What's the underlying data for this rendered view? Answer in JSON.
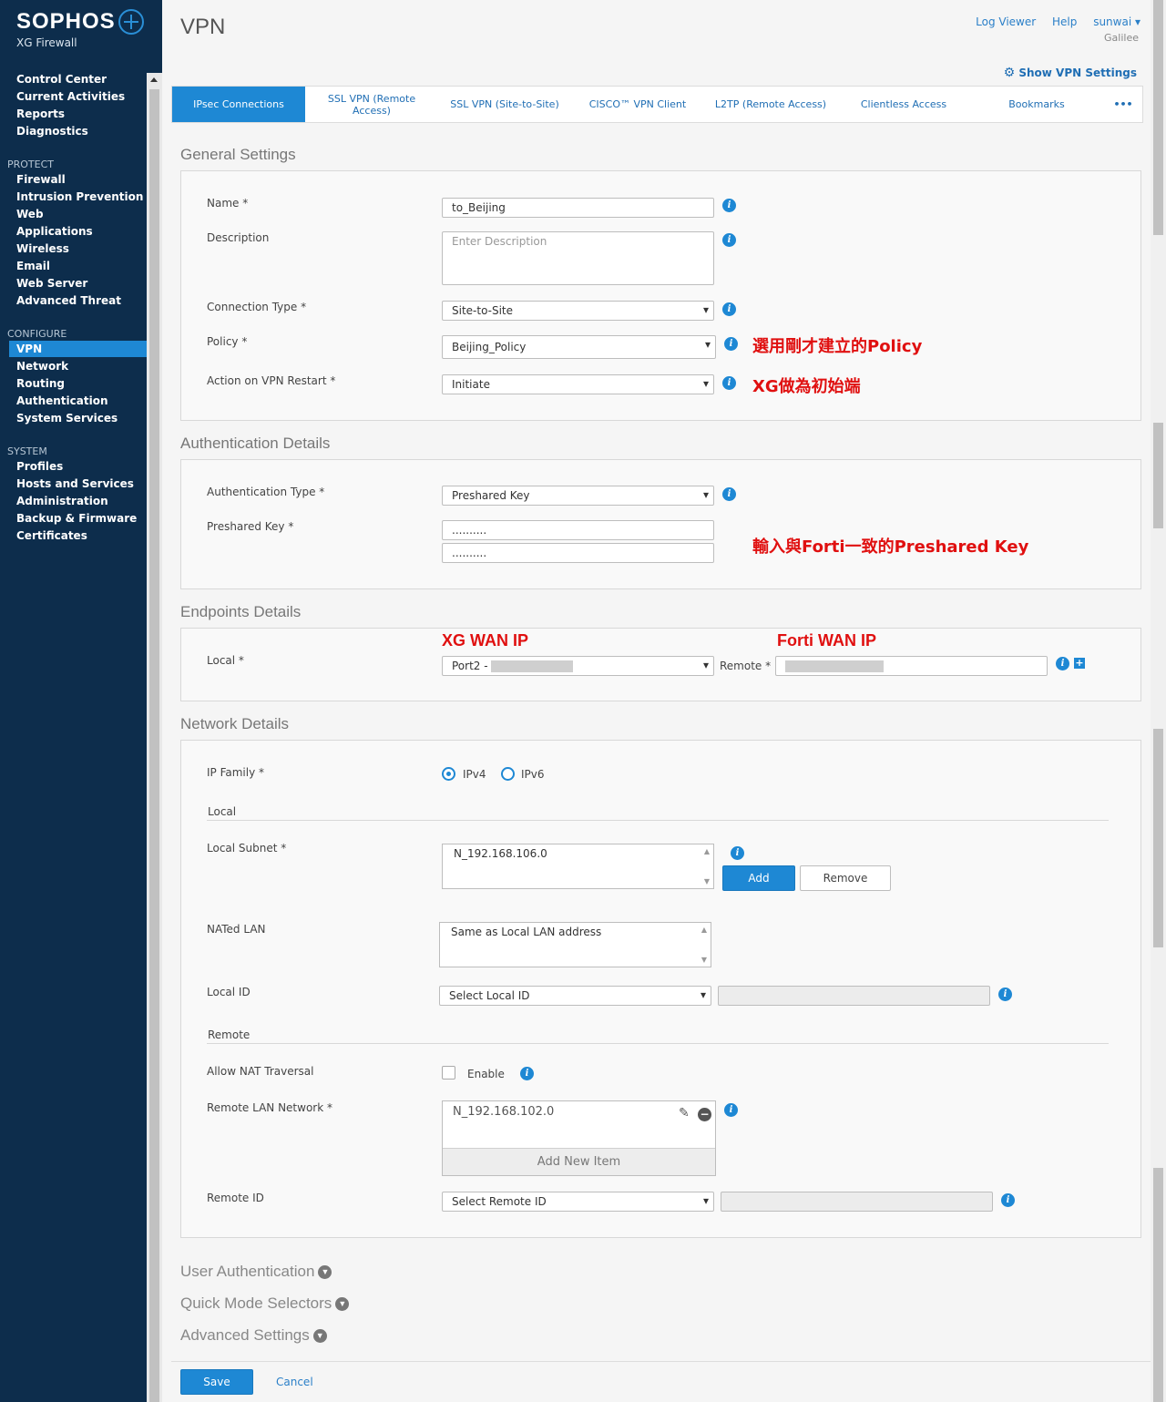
{
  "brand": {
    "name": "SOPHOS",
    "product": "XG Firewall"
  },
  "sidebar": {
    "top_items": [
      "Control Center",
      "Current Activities",
      "Reports",
      "Diagnostics"
    ],
    "protect_label": "PROTECT",
    "protect_items": [
      "Firewall",
      "Intrusion Prevention",
      "Web",
      "Applications",
      "Wireless",
      "Email",
      "Web Server",
      "Advanced Threat"
    ],
    "configure_label": "CONFIGURE",
    "configure_items": [
      "VPN",
      "Network",
      "Routing",
      "Authentication",
      "System Services"
    ],
    "system_label": "SYSTEM",
    "system_items": [
      "Profiles",
      "Hosts and Services",
      "Administration",
      "Backup & Firmware",
      "Certificates"
    ]
  },
  "header": {
    "title": "VPN",
    "log_viewer": "Log Viewer",
    "help": "Help",
    "user": "sunwai ▾",
    "device": "Galilee",
    "show_vpn_settings": "Show VPN Settings"
  },
  "tabs": [
    "IPsec Connections",
    "SSL VPN (Remote Access)",
    "SSL VPN (Site-to-Site)",
    "CISCO™ VPN Client",
    "L2TP (Remote Access)",
    "Clientless Access",
    "Bookmarks",
    "•••"
  ],
  "general": {
    "title": "General Settings",
    "name_label": "Name *",
    "name_value": "to_Beijing",
    "description_label": "Description",
    "description_placeholder": "Enter Description",
    "connection_type_label": "Connection Type *",
    "connection_type_value": "Site-to-Site",
    "policy_label": "Policy *",
    "policy_value": "Beijing_Policy",
    "action_label": "Action on VPN Restart *",
    "action_value": "Initiate"
  },
  "auth": {
    "title": "Authentication Details",
    "type_label": "Authentication Type *",
    "type_value": "Preshared Key",
    "key_label": "Preshared Key *",
    "key_value": "..........",
    "key_confirm": ".........."
  },
  "endpoints": {
    "title": "Endpoints Details",
    "local_label": "Local *",
    "local_value": "Port2 - ",
    "remote_label": "Remote *"
  },
  "network": {
    "title": "Network Details",
    "ip_family_label": "IP Family *",
    "ipv4": "IPv4",
    "ipv6": "IPv6",
    "local_heading": "Local",
    "local_subnet_label": "Local Subnet *",
    "local_subnet_value": "N_192.168.106.0",
    "add": "Add",
    "remove": "Remove",
    "nated_lan_label": "NATed LAN",
    "nated_lan_value": "Same as Local LAN address",
    "local_id_label": "Local ID",
    "local_id_value": "Select Local ID",
    "remote_heading": "Remote",
    "nat_traversal_label": "Allow NAT Traversal",
    "enable": "Enable",
    "remote_lan_label": "Remote LAN Network *",
    "remote_lan_value": "N_192.168.102.0",
    "add_new_item": "Add New Item",
    "remote_id_label": "Remote ID",
    "remote_id_value": "Select Remote ID"
  },
  "collapsed": [
    "User Authentication",
    "Quick Mode Selectors",
    "Advanced Settings"
  ],
  "footer": {
    "save": "Save",
    "cancel": "Cancel"
  },
  "annotations": {
    "policy": "選用剛才建立的Policy",
    "initiator": "XG做為初始端",
    "preshared": "輸入與Forti一致的Preshared Key",
    "xg_wan": "XG WAN IP",
    "forti_wan": "Forti WAN IP"
  }
}
